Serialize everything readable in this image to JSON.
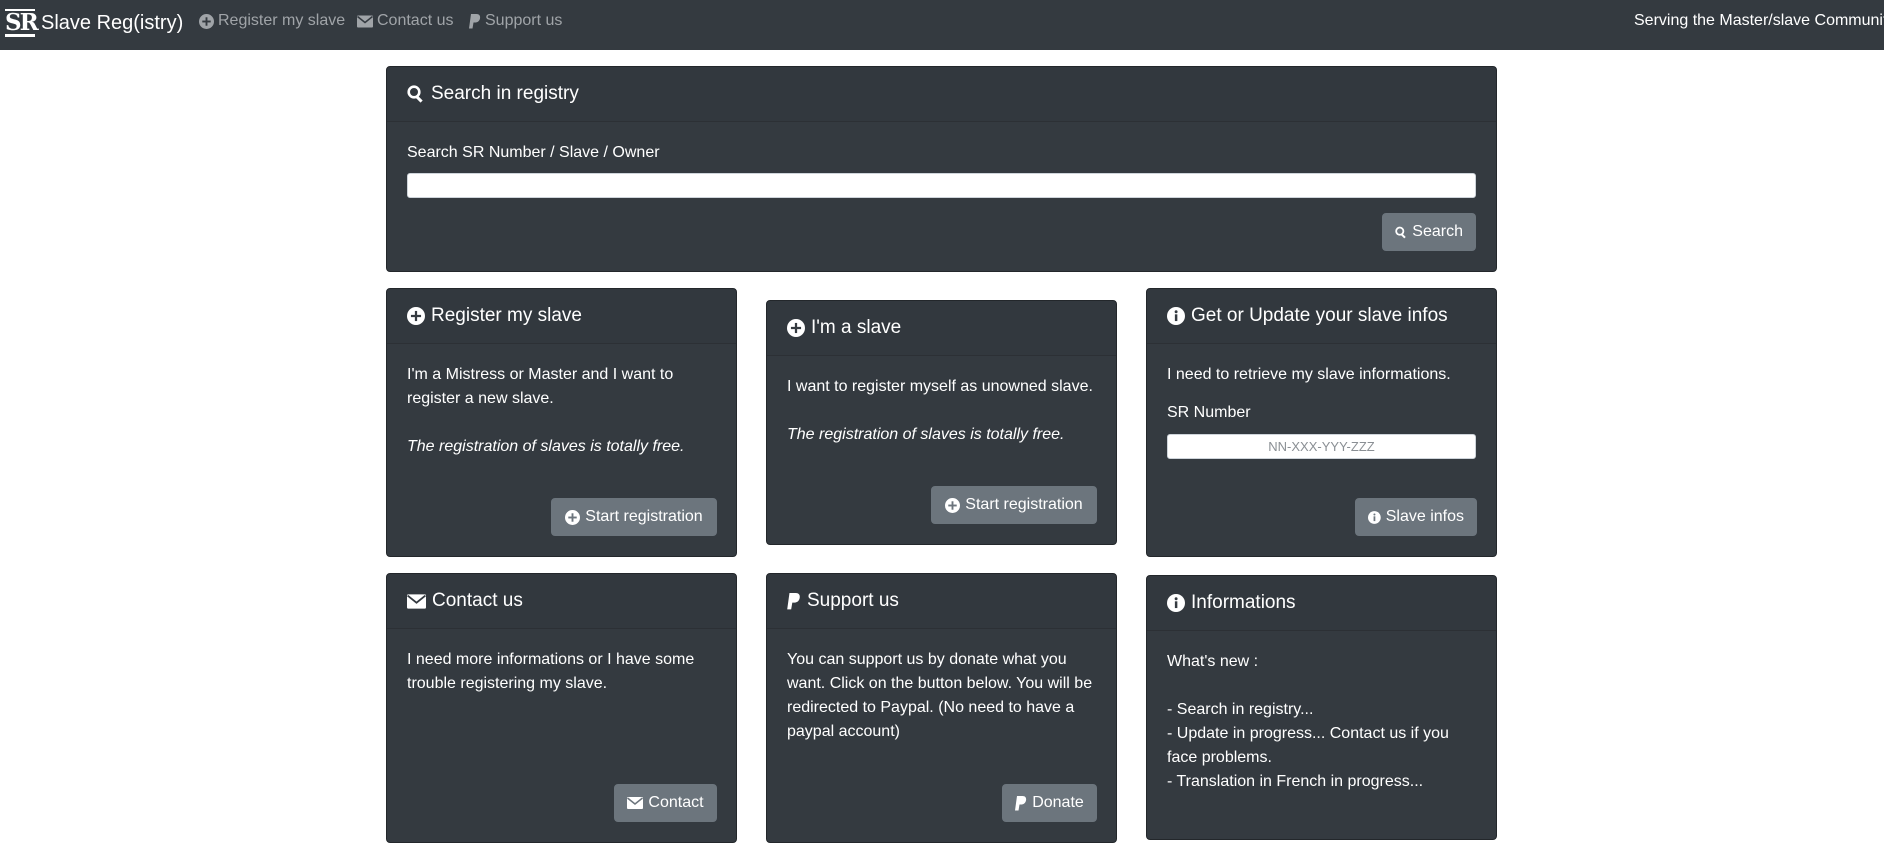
{
  "navbar": {
    "logo": "SR",
    "brand": "Slave Reg(istry)",
    "links": [
      {
        "label": "Register my slave",
        "icon": "plus-circle-icon"
      },
      {
        "label": "Contact us",
        "icon": "envelope-icon"
      },
      {
        "label": "Support us",
        "icon": "paypal-icon"
      }
    ],
    "tagline": "Serving the Master/slave Communit"
  },
  "search": {
    "title": "Search in registry",
    "label": "Search SR Number / Slave / Owner",
    "value": "",
    "button": "Search"
  },
  "register": {
    "title": "Register my slave",
    "text": "I'm a Mistress or Master and I want to register a new slave.",
    "note": "The registration of slaves is totally free.",
    "button": "Start registration"
  },
  "slave": {
    "title": "I'm a slave",
    "text": "I want to register myself as unowned slave.",
    "note": "The registration of slaves is totally free.",
    "button": "Start registration"
  },
  "infos": {
    "title": "Get or Update your slave infos",
    "text": "I need to retrieve my slave informations.",
    "label": "SR Number",
    "placeholder": "NN-XXX-YYY-ZZZ",
    "button": "Slave infos"
  },
  "contact": {
    "title": "Contact us",
    "text": "I need more informations or I have some trouble registering my slave.",
    "button": "Contact"
  },
  "support": {
    "title": "Support us",
    "text": "You can support us by donate what you want. Click on the button below. You will be redirected to Paypal. (No need to have a paypal account)",
    "button": "Donate"
  },
  "news": {
    "title": "Informations",
    "heading": "What's new :",
    "items": [
      "- Search in registry...",
      "- Update in progress... Contact us if you face problems.",
      "- Translation in French in progress..."
    ]
  },
  "colors": {
    "navbar": "#343a40",
    "card": "#343a40",
    "button": "#6c757d",
    "nav_link": "#a0a4a8"
  }
}
